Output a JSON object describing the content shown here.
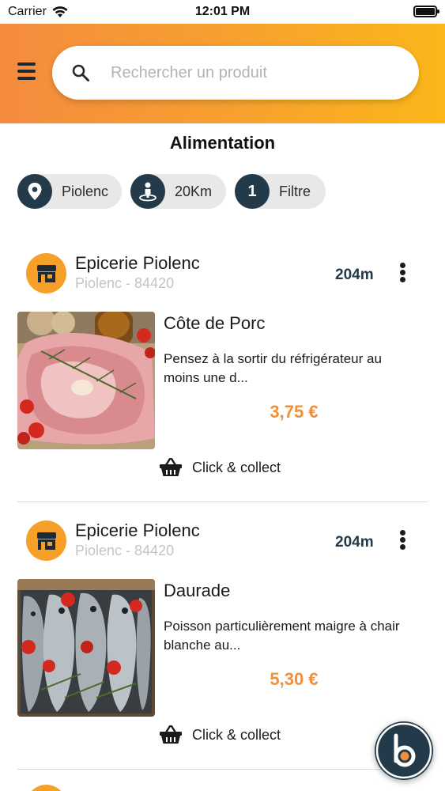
{
  "status_bar": {
    "carrier": "Carrier",
    "time": "12:01 PM"
  },
  "header": {
    "search": {
      "placeholder": "Rechercher un produit",
      "value": ""
    }
  },
  "page_title": "Alimentation",
  "filters": [
    {
      "icon": "location-pin-icon",
      "label": "Piolenc"
    },
    {
      "icon": "radius-person-icon",
      "label": "20Km"
    },
    {
      "icon": "count-badge",
      "badge": "1",
      "label": "Filtre"
    }
  ],
  "products": [
    {
      "shop_name": "Epicerie Piolenc",
      "shop_location": "Piolenc - 84420",
      "distance": "204m",
      "name": "Côte de Porc",
      "description": "Pensez à la sortir du réfrigérateur au moins une d...",
      "price": "3,75 €",
      "action": "Click & collect",
      "image": "pork-chops-photo"
    },
    {
      "shop_name": "Epicerie Piolenc",
      "shop_location": "Piolenc - 84420",
      "distance": "204m",
      "name": "Daurade",
      "description": "Poisson particulièrement maigre à chair blanche au...",
      "price": "5,30 €",
      "action": "Click & collect",
      "image": "sea-bream-photo"
    }
  ],
  "colors": {
    "header_gradient_start": "#f58b3e",
    "header_gradient_end": "#fbb71a",
    "accent_orange": "#f18f3b",
    "navy": "#233a4a",
    "chip_bg": "#e8e8e8"
  }
}
